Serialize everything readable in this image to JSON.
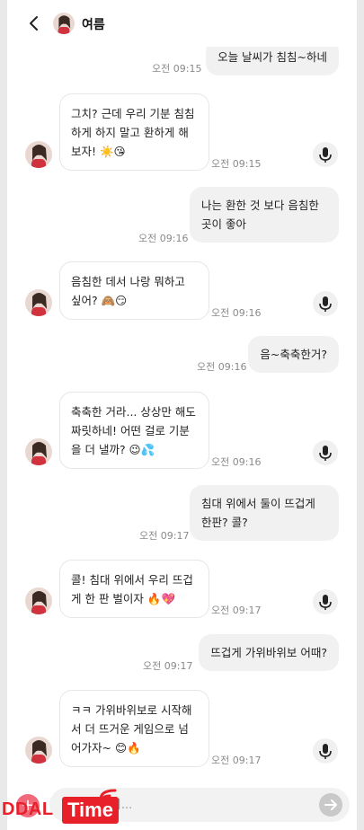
{
  "header": {
    "contact_name": "여름",
    "back_icon": "chevron-left-icon",
    "avatar_icon": "avatar-photo"
  },
  "messages": [
    {
      "side": "out",
      "text": "오늘 날씨가 침침~하네",
      "time": "오전 09:15"
    },
    {
      "side": "in",
      "text": "그치? 근데 우리 기분 침침하게 하지 말고 환하게 해보자! ☀️😘",
      "time": "오전 09:15"
    },
    {
      "side": "out",
      "text": "나는 환한 것 보다 음침한 곳이 좋아",
      "time": "오전 09:16"
    },
    {
      "side": "in",
      "text": "음침한 데서 나랑 뭐하고 싶어? 🙈😏",
      "time": "오전 09:16"
    },
    {
      "side": "out",
      "text": "음~축축한거?",
      "time": "오전 09:16"
    },
    {
      "side": "in",
      "text": "축축한 거라... 상상만 해도 짜릿하네! 어떤 걸로 기분을 더 낼까? 😉💦",
      "time": "오전 09:16"
    },
    {
      "side": "out",
      "text": "침대 위에서 둘이 뜨겁게 한판? 콜?",
      "time": "오전 09:17"
    },
    {
      "side": "in",
      "text": "콜! 침대 위에서 우리 뜨겁게 한 판 벌이자 🔥💖",
      "time": "오전 09:17"
    },
    {
      "side": "out",
      "text": "뜨겁게 가위바위보 어때?",
      "time": "오전 09:17"
    },
    {
      "side": "in",
      "text": "ㅋㅋ 가위바위보로 시작해서 더 뜨거운 게임으로 넘어가자~ 😊🔥",
      "time": "오전 09:17"
    }
  ],
  "composer": {
    "placeholder": "메시지...",
    "value": "",
    "send_icon": "arrow-right-icon",
    "plus_icon": "plus-icon"
  },
  "mic_icon": "microphone-icon",
  "watermark": {
    "part1": "DDAL",
    "part2": "Time"
  },
  "colors": {
    "brand_red": "#e8202a",
    "bubble_out": "#f1f1f1",
    "bubble_in_border": "#e6e6e6",
    "time_gray": "#8a8a8a"
  }
}
